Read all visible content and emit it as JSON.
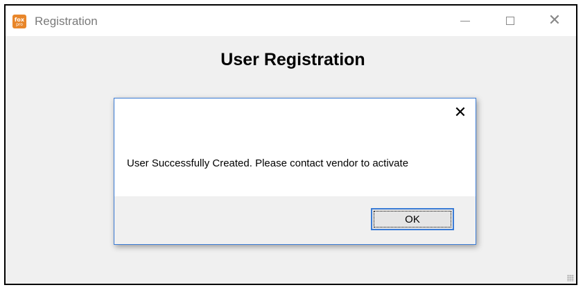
{
  "window": {
    "title": "Registration",
    "icon": "foxpro-app-icon",
    "icon_text_top": "fox",
    "icon_text_bottom": "pro",
    "controls": {
      "minimize": "minimize-icon",
      "maximize": "maximize-icon",
      "close": "close-icon"
    }
  },
  "form": {
    "heading": "User Registration"
  },
  "dialog": {
    "message": "User Successfully Created. Please contact vendor to activate",
    "ok_label": "OK",
    "close_icon": "close-icon"
  },
  "colors": {
    "accent": "#3a7bd5",
    "window_bg": "#f0f0f0",
    "app_icon": "#e8862a"
  }
}
